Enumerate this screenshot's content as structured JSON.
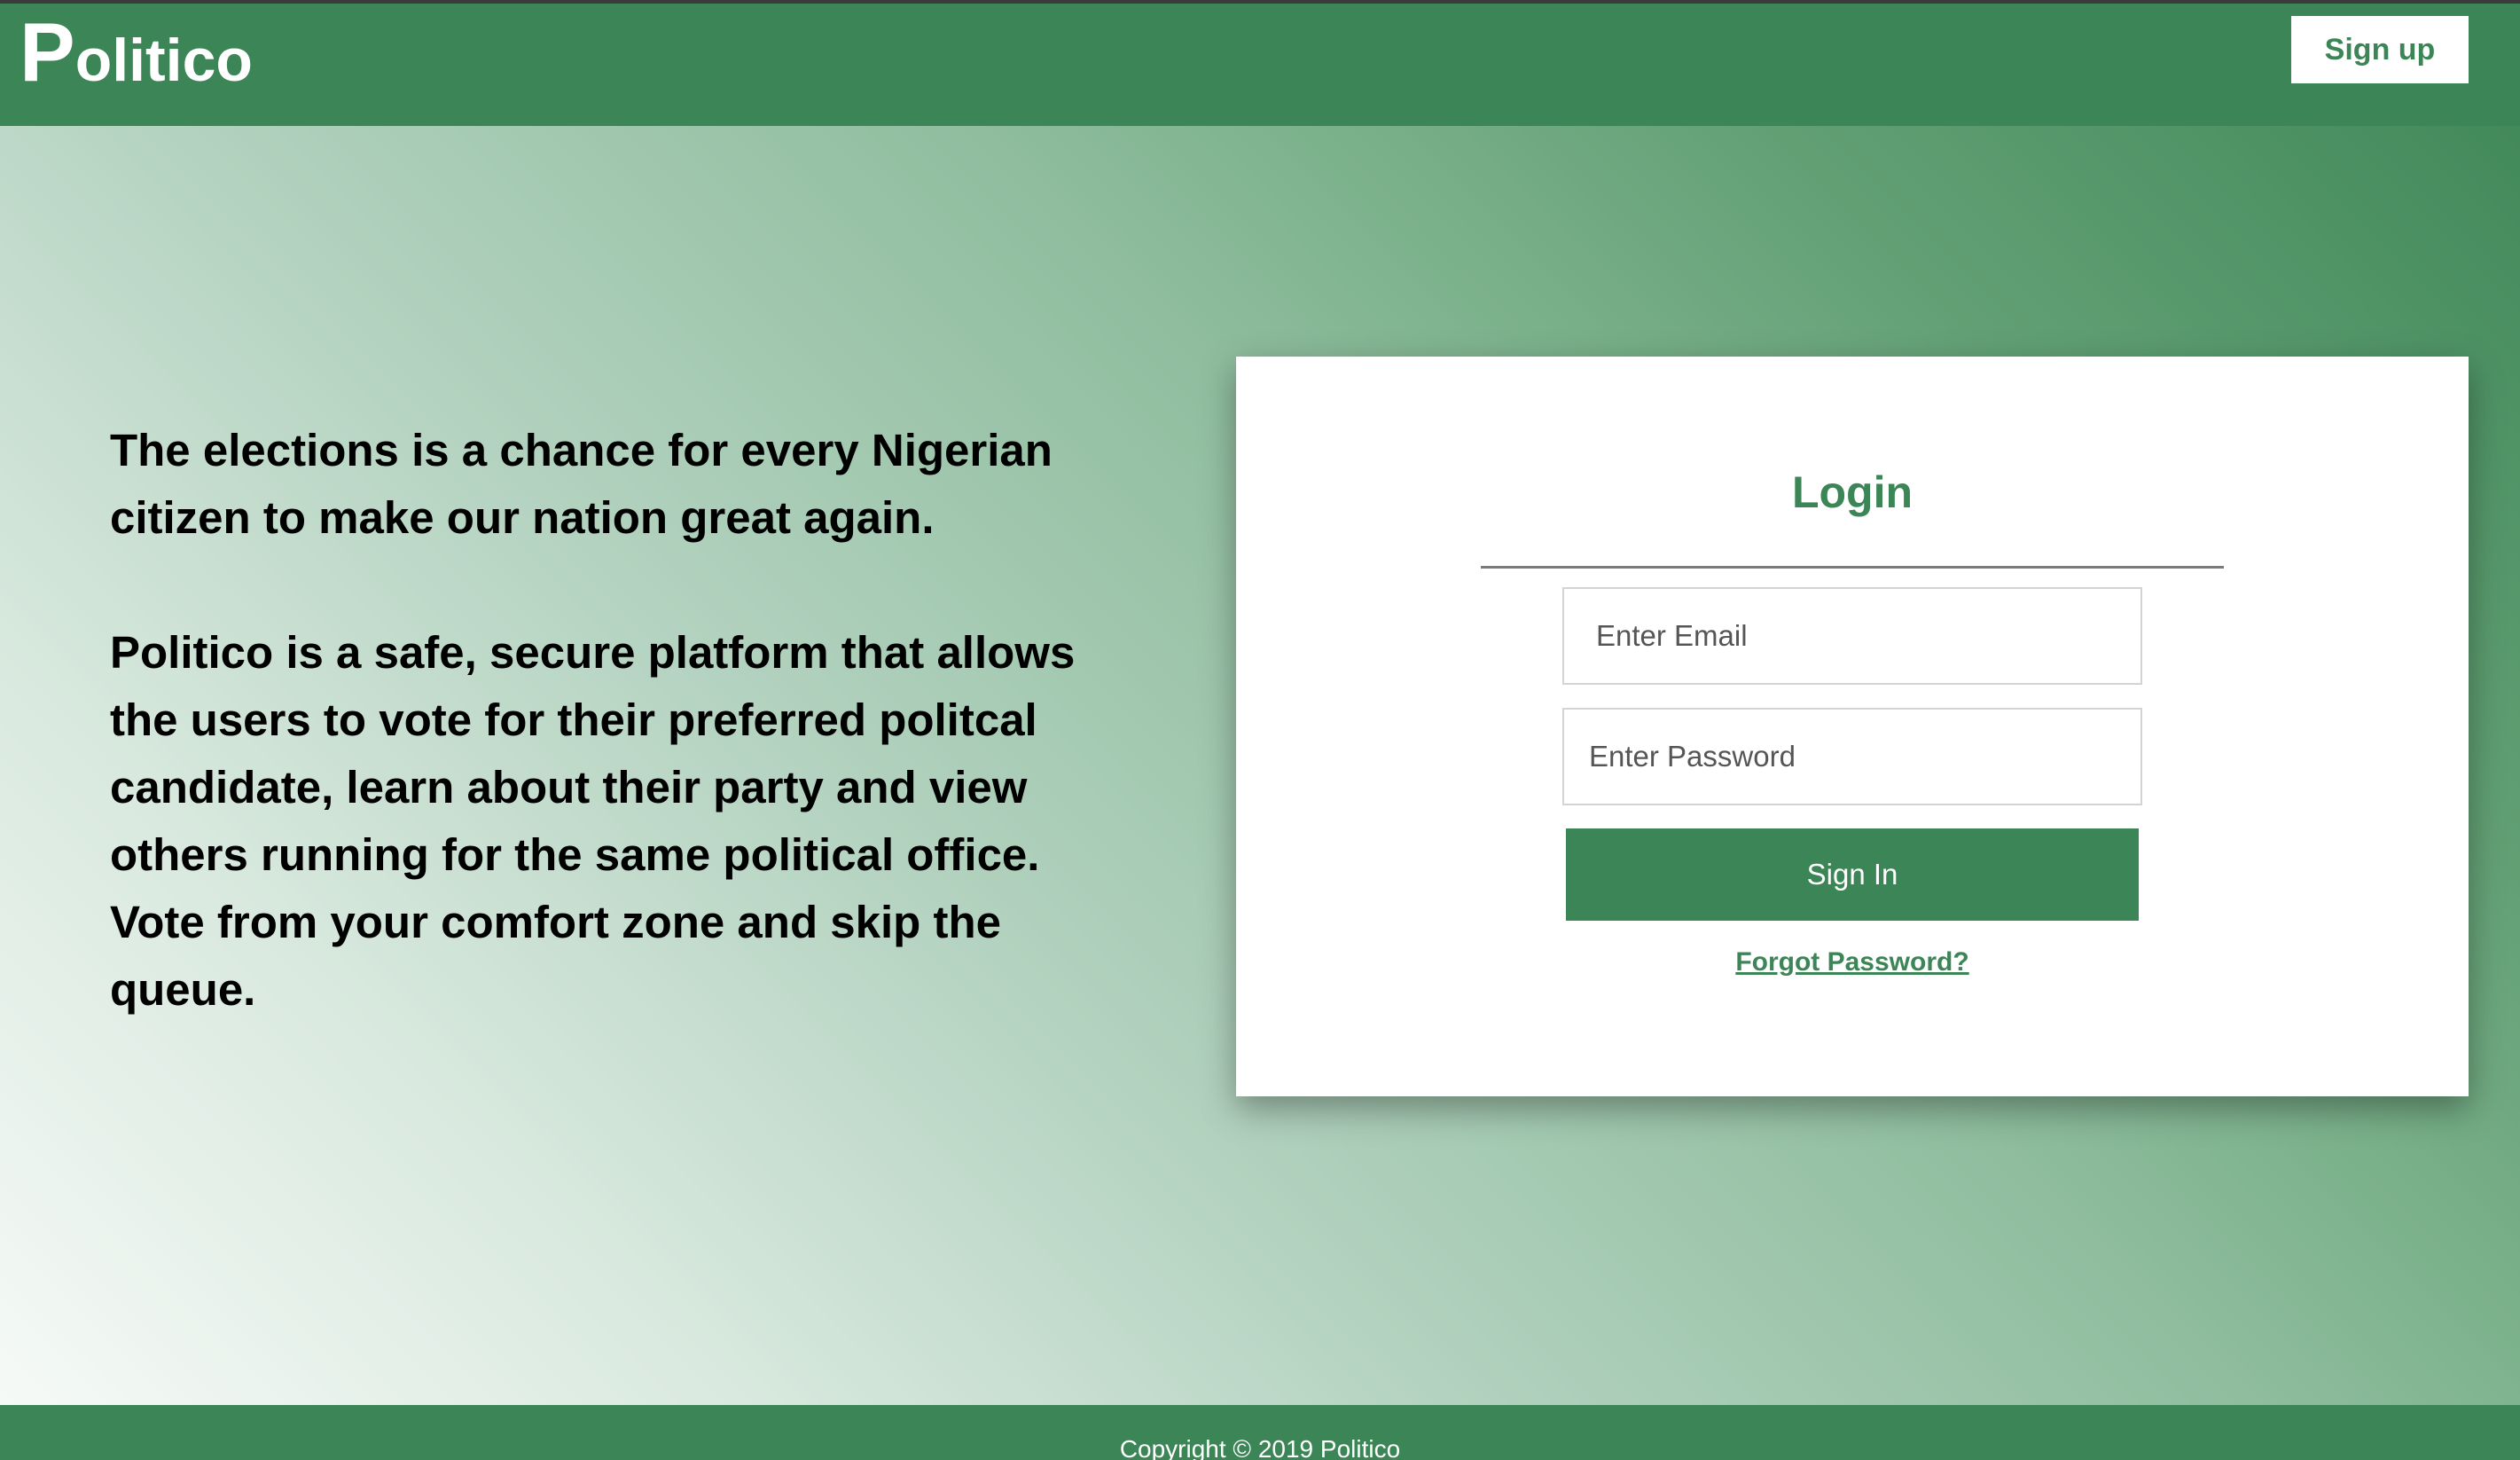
{
  "header": {
    "logo_initial": "P",
    "logo_rest": "olitico",
    "signup_label": "Sign up"
  },
  "intro": {
    "paragraph_1": "The elections is a chance for every Nigerian citizen to make our nation great again.",
    "paragraph_2": "Politico is a safe, secure platform that allows the users to vote for their preferred politcal candidate, learn about their party and view others running for the same political office. Vote from your comfort zone and skip the queue."
  },
  "login": {
    "title": "Login",
    "email_placeholder": "Enter Email",
    "email_value": "",
    "password_placeholder": "Enter Password",
    "password_value": "",
    "signin_label": "Sign In",
    "forgot_label": "Forgot Password?"
  },
  "footer": {
    "copyright": "Copyright © 2019 Politico"
  },
  "colors": {
    "brand_green": "#3c8556",
    "button_text": "#ffffff",
    "body_text": "#000000"
  }
}
